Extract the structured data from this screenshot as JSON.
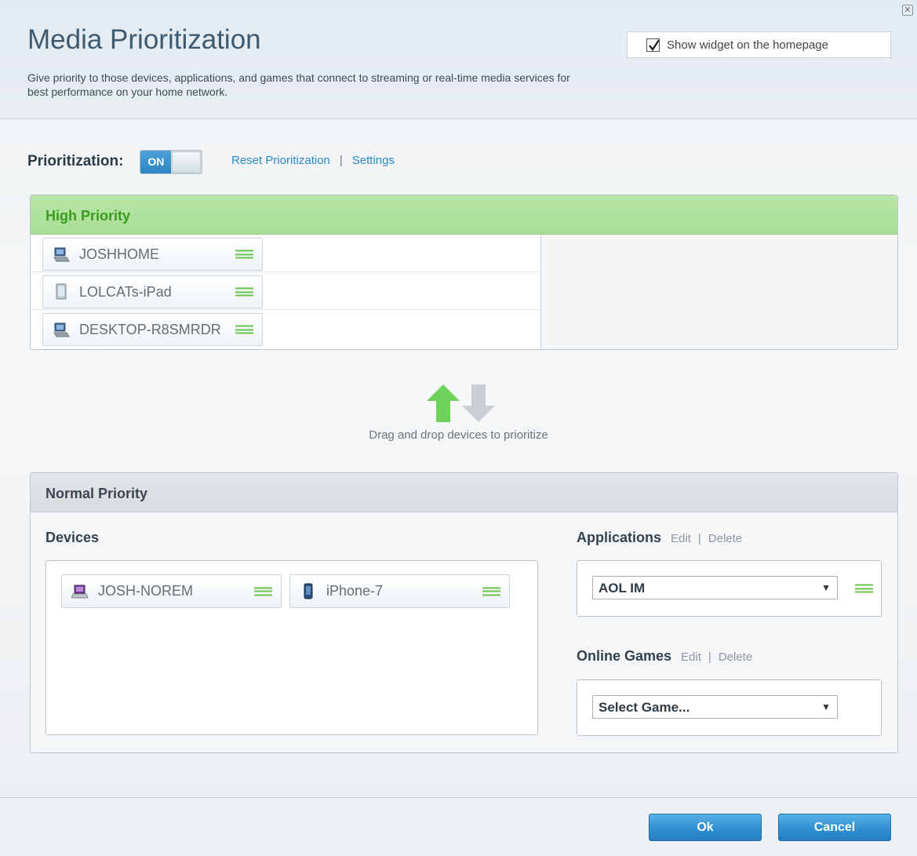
{
  "window": {
    "close_glyph": "✕"
  },
  "header": {
    "title": "Media Prioritization",
    "description": "Give priority to those devices, applications, and games that connect to streaming or real-time media services for best performance on your home network.",
    "widget_checkbox": {
      "label": "Show widget on the homepage",
      "checked": true
    }
  },
  "prioritization": {
    "label": "Prioritization:",
    "toggle_state": "ON",
    "reset_link": "Reset Prioritization",
    "separator": "|",
    "settings_link": "Settings"
  },
  "high_priority": {
    "title": "High Priority",
    "devices": [
      {
        "name": "JOSHHOME",
        "icon": "desktop-icon"
      },
      {
        "name": "LOLCATs-iPad",
        "icon": "tablet-icon"
      },
      {
        "name": "DESKTOP-R8SMRDR",
        "icon": "desktop-icon"
      }
    ]
  },
  "drag_drop": {
    "text": "Drag and drop devices to prioritize"
  },
  "normal_priority": {
    "title": "Normal Priority",
    "devices_label": "Devices",
    "devices": [
      {
        "name": "JOSH-NOREM",
        "icon": "laptop-icon"
      },
      {
        "name": "iPhone-7",
        "icon": "phone-icon"
      }
    ],
    "applications": {
      "label": "Applications",
      "edit": "Edit",
      "separator": "|",
      "delete": "Delete",
      "selected": "AOL IM"
    },
    "online_games": {
      "label": "Online Games",
      "edit": "Edit",
      "separator": "|",
      "delete": "Delete",
      "selected": "Select Game..."
    }
  },
  "footer": {
    "ok_label": "Ok",
    "cancel_label": "Cancel"
  },
  "colors": {
    "accent_blue": "#2b8ac6",
    "high_priority_green": "#3a9b1f",
    "grip_green": "#6cc24a"
  }
}
